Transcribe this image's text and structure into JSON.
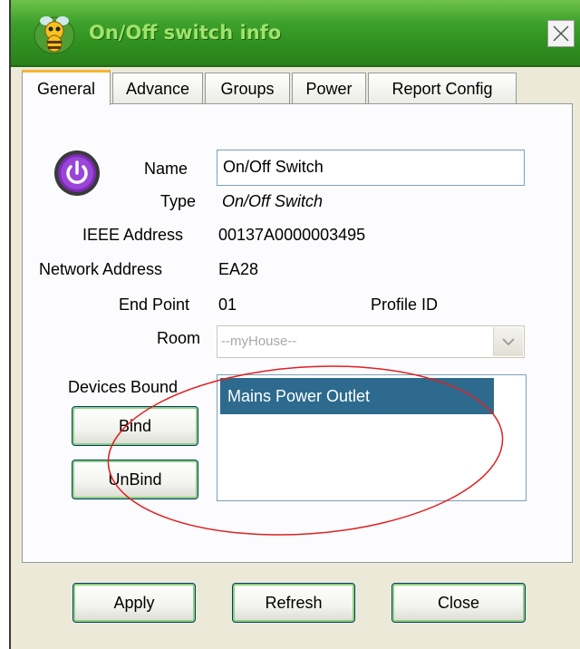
{
  "window": {
    "title": "On/Off switch info"
  },
  "tabs": [
    "General",
    "Advance",
    "Groups",
    "Power",
    "Report Config"
  ],
  "device": {
    "name_label": "Name",
    "name_value": "On/Off Switch",
    "type_label": "Type",
    "type_value": "On/Off Switch",
    "ieee_label": "IEEE Address",
    "ieee_value": "00137A0000003495",
    "network_label": "Network Address",
    "network_value": "EA28",
    "endpoint_label": "End Point",
    "endpoint_value": "01",
    "profile_label": "Profile ID",
    "room_label": "Room",
    "room_value": "--myHouse--",
    "bound_label": "Devices Bound",
    "bound_items": [
      "Mains Power Outlet"
    ]
  },
  "buttons": {
    "bind": "Bind",
    "unbind": "UnBind",
    "apply": "Apply",
    "refresh": "Refresh",
    "close": "Close"
  },
  "colors": {
    "titlebar": "#3da12c",
    "selection": "#2d6a8e",
    "annotation": "#e02020"
  }
}
